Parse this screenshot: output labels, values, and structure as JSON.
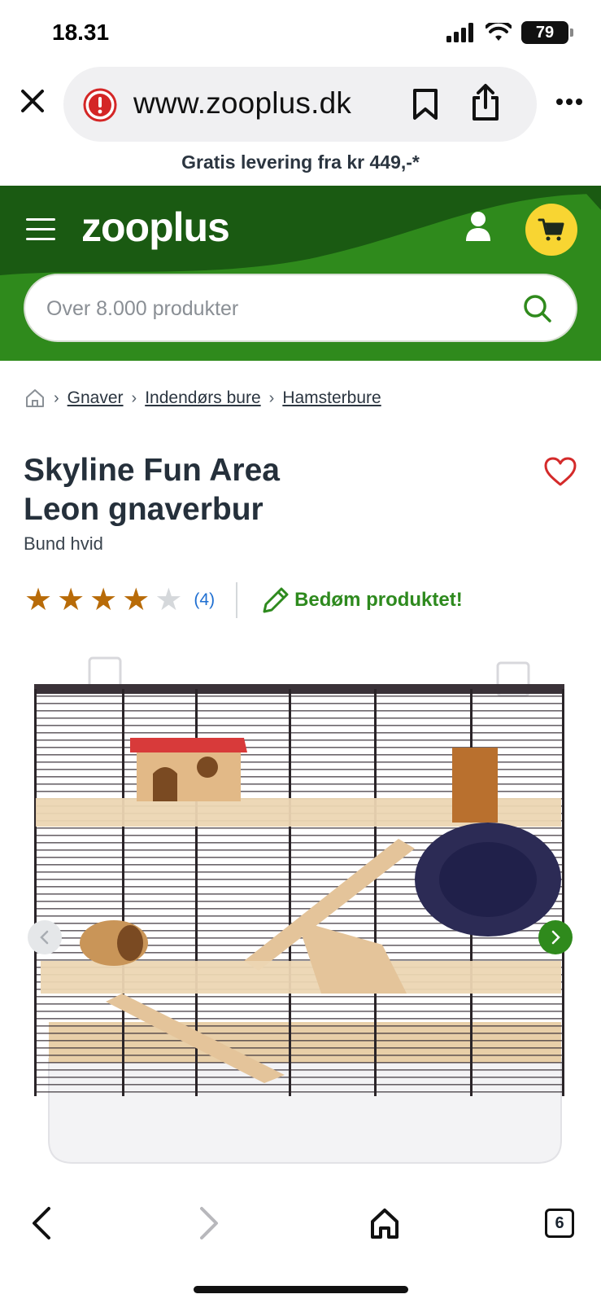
{
  "status_bar": {
    "time": "18.31",
    "battery": "79"
  },
  "browser": {
    "url": "www.zooplus.dk",
    "tab_count": "6"
  },
  "promo": {
    "text": "Gratis levering fra kr 449,-*"
  },
  "header": {
    "logo": "zooplus",
    "search_placeholder": "Over 8.000 produkter",
    "accent_color": "#2f8a1c",
    "cart_color": "#f8d532"
  },
  "breadcrumb": {
    "items": [
      "Gnaver",
      "Indendørs bure",
      "Hamsterbure"
    ]
  },
  "product": {
    "title_line1": "Skyline Fun Area",
    "title_line2": "Leon gnaverbur",
    "subtitle": "Bund hvid",
    "rating": 4,
    "rating_max": 5,
    "review_count": "(4)",
    "rate_cta": "Bedøm produktet!"
  }
}
